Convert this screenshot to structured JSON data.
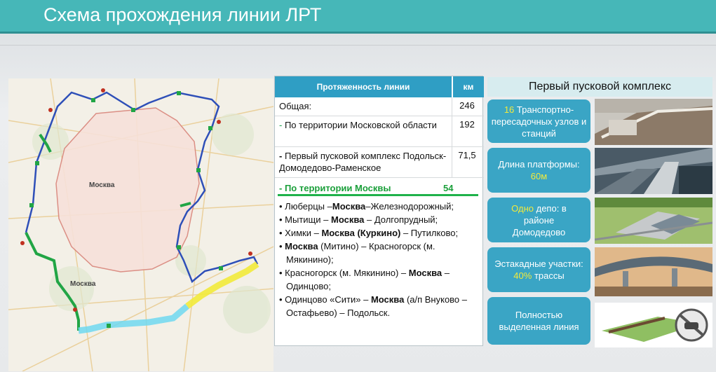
{
  "header": {
    "title": "Схема прохождения линии ЛРТ"
  },
  "map": {
    "label_center": "Москва",
    "label_left": "Москва"
  },
  "table": {
    "col1": "Протяженность линии",
    "col2": "км",
    "rows": [
      {
        "label": "Общая:",
        "value": "246"
      },
      {
        "label": "По территории Московской области",
        "value": "192"
      },
      {
        "label": "Первый пусковой комплекс Подольск-Домодедово-Раменское",
        "value": "71,5"
      }
    ],
    "moscow": {
      "label": "По территории Москвы",
      "value": "54"
    },
    "routes": [
      [
        "Люберцы –",
        "Москва",
        "–Железнодорожный;"
      ],
      [
        "Мытищи – ",
        "Москва",
        " – Долгопрудный;"
      ],
      [
        "Химки – ",
        "Москва (Куркино)",
        " – Путилково;"
      ],
      [
        "",
        "Москва",
        " (Митино) – Красногорск (м. Мякинино);"
      ],
      [
        "Красногорск (м. Мякинино) – ",
        "Москва",
        " – Одинцово;"
      ],
      [
        "Одинцово «Сити» – ",
        "Москва",
        " (а/п Внуково – Остафьево) – Подольск."
      ]
    ]
  },
  "right": {
    "title": "Первый пусковой комплекс",
    "boxes": [
      {
        "hl": "16",
        "text": " Транспортно-пересадочных узлов и станций"
      },
      {
        "text": "Длина платформы:",
        "hl": "60м"
      },
      {
        "hl": "Одно",
        "text": " депо: в районе Домодедово"
      },
      {
        "text": "Эстакадные участки:",
        "hl": "40%",
        "tail": " трассы"
      },
      {
        "text": "Полностью выделенная линия"
      }
    ]
  },
  "colors": {
    "header": "#46b7b8",
    "box": "#3aa5c5",
    "highlight": "#f2ea3b",
    "green": "#1aa34a"
  }
}
